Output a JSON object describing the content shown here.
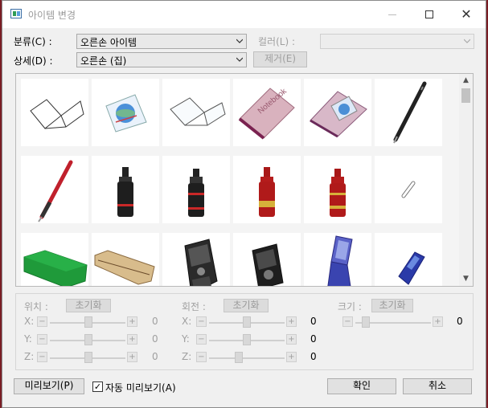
{
  "window": {
    "title": "아이템 변경"
  },
  "top": {
    "category_label": "분류(C) :",
    "category_value": "오른손 아이템",
    "detail_label": "상세(D) :",
    "detail_value": "오른손 (집)",
    "color_label": "컬러(L) :",
    "color_value": "",
    "remove_label": "제거(E)"
  },
  "grid": {
    "items": [
      "open-book",
      "book-with-globe",
      "open-notebook",
      "notebook-pink",
      "notebook-purple",
      "black-pen",
      "red-pen",
      "black-bottle-1",
      "black-bottle-2",
      "red-bottle-1",
      "red-bottle-2",
      "chalk-stick",
      "green-eraser",
      "pencil-case",
      "black-phone-1",
      "black-phone-2",
      "blue-flip-phone",
      "blue-phone"
    ]
  },
  "props": {
    "position": {
      "label": "위치 :",
      "reset": "초기화",
      "x": "0",
      "y": "0",
      "z": "0"
    },
    "rotation": {
      "label": "회전 :",
      "reset": "초기화",
      "x": "0",
      "y": "0",
      "z": "0"
    },
    "scale": {
      "label": "크기 :",
      "reset": "초기화",
      "value": "0"
    },
    "axis_x": "X:",
    "axis_y": "Y:",
    "axis_z": "Z:",
    "minus": "−",
    "plus": "+"
  },
  "bottom": {
    "preview_label": "미리보기(P)",
    "auto_preview_label": "자동 미리보기(A)",
    "auto_preview_checked": true,
    "ok_label": "확인",
    "cancel_label": "취소"
  },
  "colors": {
    "accent_disabled": "#a0a0a0",
    "panel_bg": "#f0f0f0"
  }
}
